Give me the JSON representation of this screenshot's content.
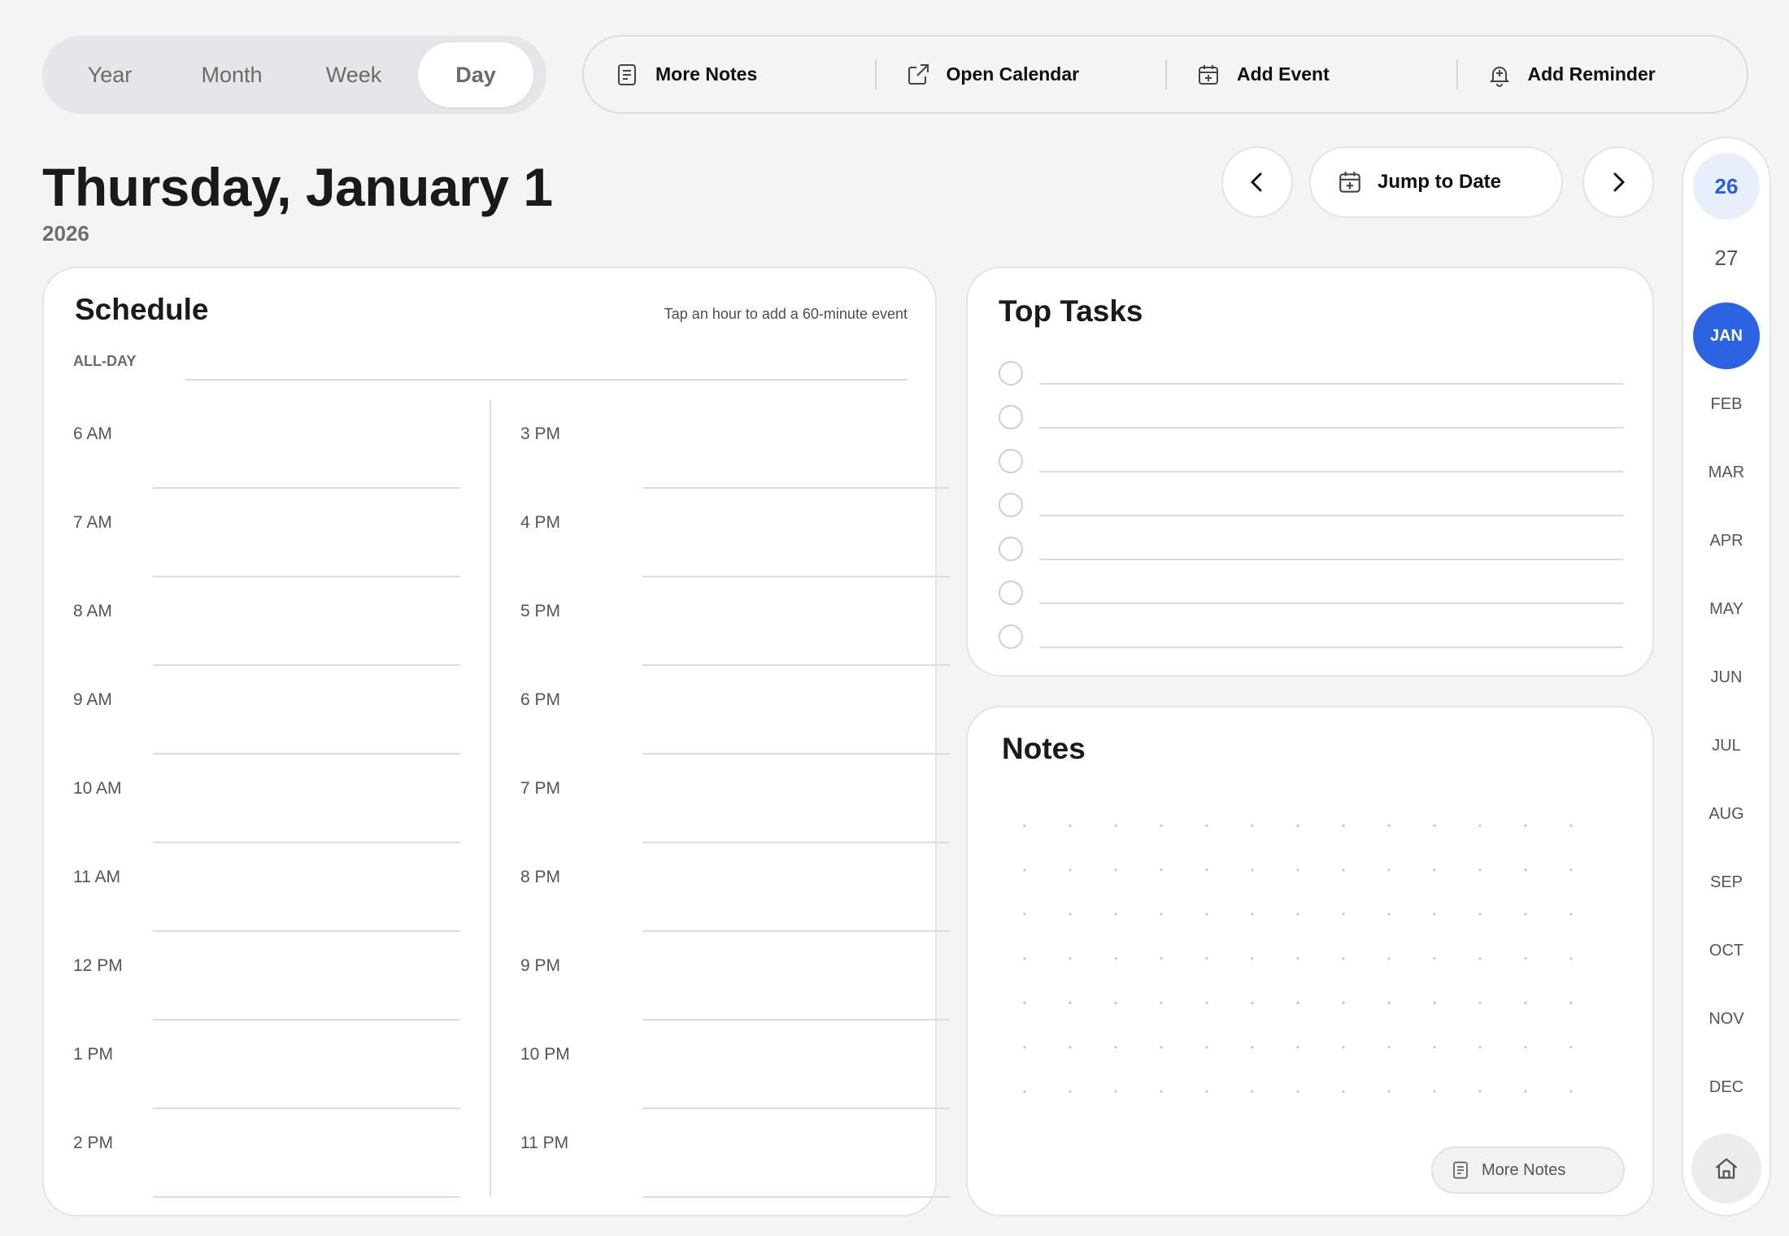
{
  "view_switch": {
    "tabs": [
      "Year",
      "Month",
      "Week",
      "Day"
    ],
    "active": "Day"
  },
  "actions": {
    "more_notes": "More Notes",
    "open_calendar": "Open Calendar",
    "add_event": "Add Event",
    "add_reminder": "Add Reminder"
  },
  "header": {
    "date": "Thursday, January 1",
    "year": "2026",
    "jump_label": "Jump to Date"
  },
  "schedule": {
    "title": "Schedule",
    "hint": "Tap an hour to add a 60-minute event",
    "all_day": "ALL-DAY",
    "left_hours": [
      "6 AM",
      "7 AM",
      "8 AM",
      "9 AM",
      "10 AM",
      "11 AM",
      "12 PM",
      "1 PM",
      "2 PM"
    ],
    "right_hours": [
      "3 PM",
      "4 PM",
      "5 PM",
      "6 PM",
      "7 PM",
      "8 PM",
      "9 PM",
      "10 PM",
      "11 PM"
    ]
  },
  "tasks": {
    "title": "Top Tasks",
    "count": 7
  },
  "notes": {
    "title": "Notes",
    "more_label": "More Notes"
  },
  "rail": {
    "years": [
      "26",
      "27"
    ],
    "selected_year": "26",
    "months": [
      "JAN",
      "FEB",
      "MAR",
      "APR",
      "MAY",
      "JUN",
      "JUL",
      "AUG",
      "SEP",
      "OCT",
      "NOV",
      "DEC"
    ],
    "selected_month": "JAN"
  },
  "colors": {
    "accent": "#2b63e0",
    "accent_soft": "#e8eefc",
    "background": "#f4f4f6"
  }
}
